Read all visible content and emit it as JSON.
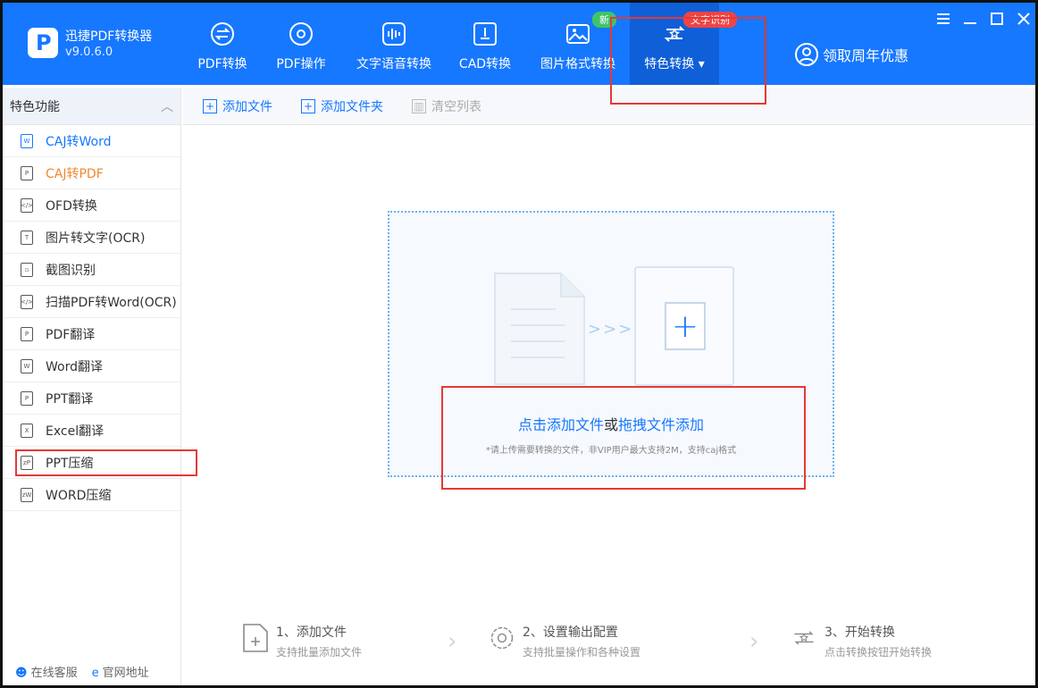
{
  "app": {
    "name": "迅捷PDF转换器",
    "version": "v9.0.6.0"
  },
  "nav": [
    {
      "label": "PDF转换",
      "icon": "pdf-convert-icon"
    },
    {
      "label": "PDF操作",
      "icon": "pdf-settings-icon"
    },
    {
      "label": "文字语音转换",
      "icon": "voice-wave-icon"
    },
    {
      "label": "CAD转换",
      "icon": "cad-icon"
    },
    {
      "label": "图片格式转换",
      "icon": "image-icon"
    },
    {
      "label": "特色转换",
      "icon": "star-refresh-icon",
      "active": true
    }
  ],
  "badges": {
    "new": "新",
    "ocr": "文字识别"
  },
  "promo": "领取周年优惠",
  "window_controls": [
    "menu-icon",
    "minimize-icon",
    "maximize-icon",
    "close-icon"
  ],
  "sidebar": {
    "title": "特色功能",
    "items": [
      {
        "label": "CAJ转Word",
        "state": "selected"
      },
      {
        "label": "CAJ转PDF",
        "state": "highlight"
      },
      {
        "label": "OFD转换"
      },
      {
        "label": "图片转文字(OCR)"
      },
      {
        "label": "截图识别"
      },
      {
        "label": "扫描PDF转Word(OCR)"
      },
      {
        "label": "PDF翻译"
      },
      {
        "label": "Word翻译"
      },
      {
        "label": "PPT翻译"
      },
      {
        "label": "Excel翻译"
      },
      {
        "label": "PPT压缩"
      },
      {
        "label": "WORD压缩"
      }
    ],
    "footer": {
      "support": "在线客服",
      "website": "官网地址"
    }
  },
  "toolbar": {
    "add_file": "添加文件",
    "add_folder": "添加文件夹",
    "clear_list": "清空列表"
  },
  "dropzone": {
    "click_add": "点击添加文件",
    "or": "或",
    "drag_add": "拖拽文件添加",
    "hint": "*请上传需要转换的文件，非VIP用户最大支持2M，支持caj格式"
  },
  "steps": [
    {
      "title": "1、添加文件",
      "desc": "支持批量添加文件"
    },
    {
      "title": "2、设置输出配置",
      "desc": "支持批量操作和各种设置"
    },
    {
      "title": "3、开始转换",
      "desc": "点击转换按钮开始转换"
    }
  ],
  "colors": {
    "primary": "#1677ff",
    "header_bg": "#1677ff",
    "active_nav": "#0f5fd9",
    "badge_new": "#3fc46a",
    "badge_ocr": "#f04444",
    "highlight_red": "#e53935",
    "orange": "#ee8833"
  }
}
